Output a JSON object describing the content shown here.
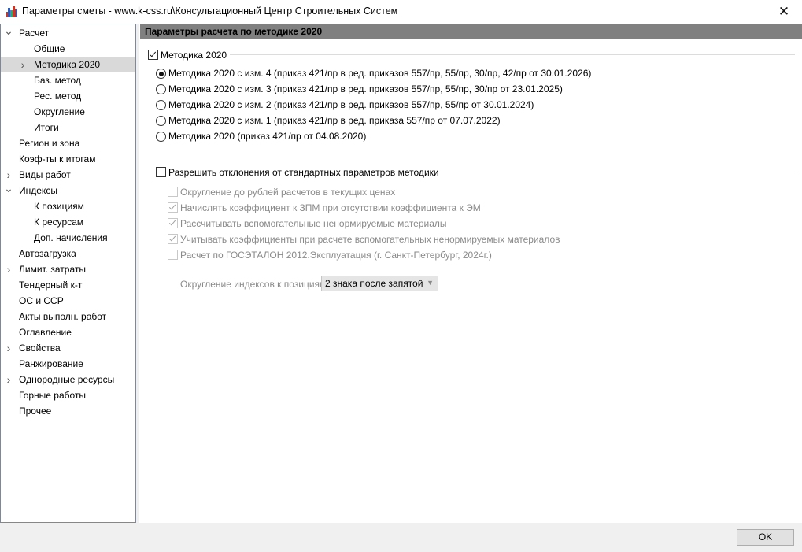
{
  "window": {
    "title": "Параметры сметы - www.k-css.ru\\Консультационный Центр Строительных Систем"
  },
  "sidebar": {
    "items": [
      {
        "label": "Расчет",
        "chevron": "expanded"
      },
      {
        "label": "Общие"
      },
      {
        "label": "Методика 2020",
        "chevron": "collapsed",
        "selected": true
      },
      {
        "label": "Баз. метод"
      },
      {
        "label": "Рес. метод"
      },
      {
        "label": "Округление"
      },
      {
        "label": "Итоги"
      },
      {
        "label": "Регион и зона"
      },
      {
        "label": "Коэф-ты к итогам"
      },
      {
        "label": "Виды работ",
        "chevron": "collapsed"
      },
      {
        "label": "Индексы",
        "chevron": "expanded"
      },
      {
        "label": "К позициям"
      },
      {
        "label": "К ресурсам"
      },
      {
        "label": "Доп. начисления"
      },
      {
        "label": "Автозагрузка"
      },
      {
        "label": "Лимит. затраты",
        "chevron": "collapsed"
      },
      {
        "label": "Тендерный к-т"
      },
      {
        "label": "ОС и ССР"
      },
      {
        "label": "Акты выполн. работ"
      },
      {
        "label": "Оглавление"
      },
      {
        "label": "Свойства",
        "chevron": "collapsed"
      },
      {
        "label": "Ранжирование"
      },
      {
        "label": "Однородные ресурсы",
        "chevron": "collapsed"
      },
      {
        "label": "Горные работы"
      },
      {
        "label": "Прочее"
      }
    ]
  },
  "main": {
    "header": "Параметры расчета по методике 2020",
    "methodology_checkbox": {
      "label": "Методика 2020",
      "checked": true
    },
    "radio_options": [
      {
        "label": "Методика 2020 с изм. 4 (приказ 421/пр в ред. приказов 557/пр, 55/пр, 30/пр, 42/пр от 30.01.2026)",
        "checked": true
      },
      {
        "label": "Методика 2020 с изм. 3 (приказ 421/пр в ред. приказов 557/пр, 55/пр, 30/пр от 23.01.2025)",
        "checked": false
      },
      {
        "label": "Методика 2020 с изм. 2 (приказ 421/пр в ред. приказов 557/пр, 55/пр от 30.01.2024)",
        "checked": false
      },
      {
        "label": "Методика 2020 с изм. 1 (приказ 421/пр в ред. приказа 557/пр от 07.07.2022)",
        "checked": false
      },
      {
        "label": "Методика 2020 (приказ 421/пр от 04.08.2020)",
        "checked": false
      }
    ],
    "allow_deviation_checkbox": {
      "label": "Разрешить отклонения от стандартных параметров методики",
      "checked": false
    },
    "deviation_options": [
      {
        "label": "Округление до рублей расчетов в текущих ценах",
        "checked": false
      },
      {
        "label": "Начислять коэффициент к ЗПМ при отсутствии коэффициента к ЭМ",
        "checked": true
      },
      {
        "label": "Рассчитывать вспомогательные ненормируемые материалы",
        "checked": true
      },
      {
        "label": "Учитывать коэффициенты при расчете вспомогательных ненормируемых материалов",
        "checked": true
      },
      {
        "label": "Расчет по ГОСЭТАЛОН 2012.Эксплуатация (г. Санкт-Петербург, 2024г.)",
        "checked": false
      }
    ],
    "rounding": {
      "label": "Округление индексов к позициям:",
      "value": "2 знака после запятой"
    }
  },
  "footer": {
    "ok_label": "OK"
  },
  "colors": {
    "header_bg": "#808080",
    "selected_bg": "#d9d9d9",
    "disabled_text": "#8a8a8a",
    "window_bg": "#f0f0f0"
  }
}
